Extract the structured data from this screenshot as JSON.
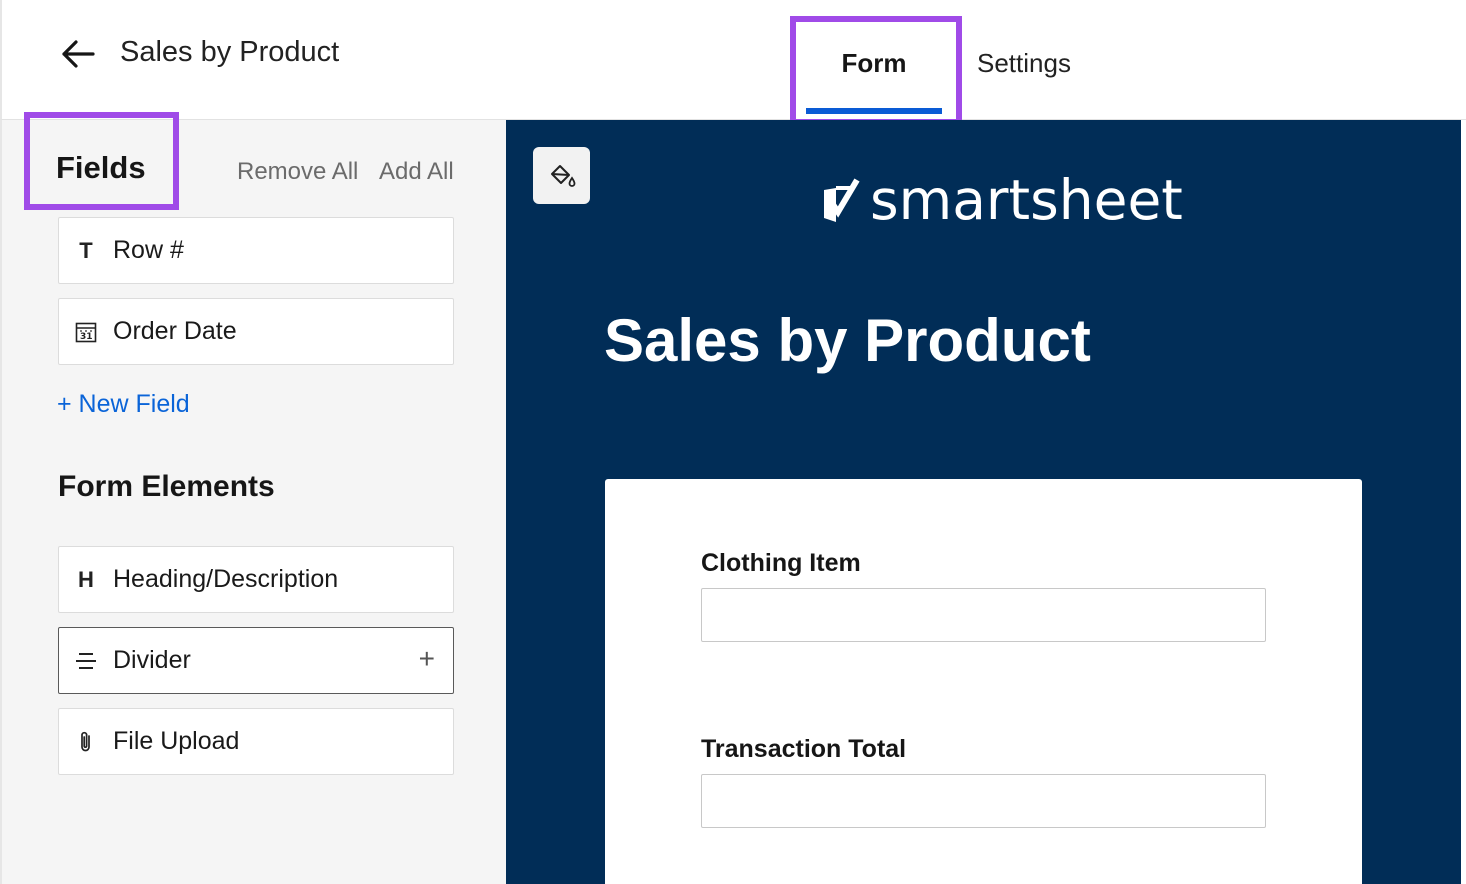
{
  "header": {
    "title": "Sales by Product",
    "tabs": [
      {
        "label": "Form",
        "active": true
      },
      {
        "label": "Settings",
        "active": false
      }
    ]
  },
  "sidebar": {
    "fields_title": "Fields",
    "remove_all": "Remove All",
    "add_all": "Add All",
    "fields": [
      {
        "label": "Row #",
        "icon": "text-type-icon",
        "glyph": "T"
      },
      {
        "label": "Order Date",
        "icon": "calendar-icon"
      }
    ],
    "new_field": "+ New Field",
    "form_elements_title": "Form Elements",
    "form_elements": [
      {
        "label": "Heading/Description",
        "icon": "heading-icon",
        "glyph": "H"
      },
      {
        "label": "Divider",
        "icon": "divider-icon",
        "hovered": true
      },
      {
        "label": "File Upload",
        "icon": "paperclip-icon"
      }
    ]
  },
  "preview": {
    "logo_text": "smartsheet",
    "form_title": "Sales by Product",
    "questions": [
      {
        "label": "Clothing Item",
        "value": ""
      },
      {
        "label": "Transaction Total",
        "value": ""
      }
    ]
  },
  "colors": {
    "accent_blue": "#0a5bd5",
    "highlight_purple": "#a04be8",
    "canvas_navy": "#012d57",
    "link_blue": "#0a64d8"
  }
}
